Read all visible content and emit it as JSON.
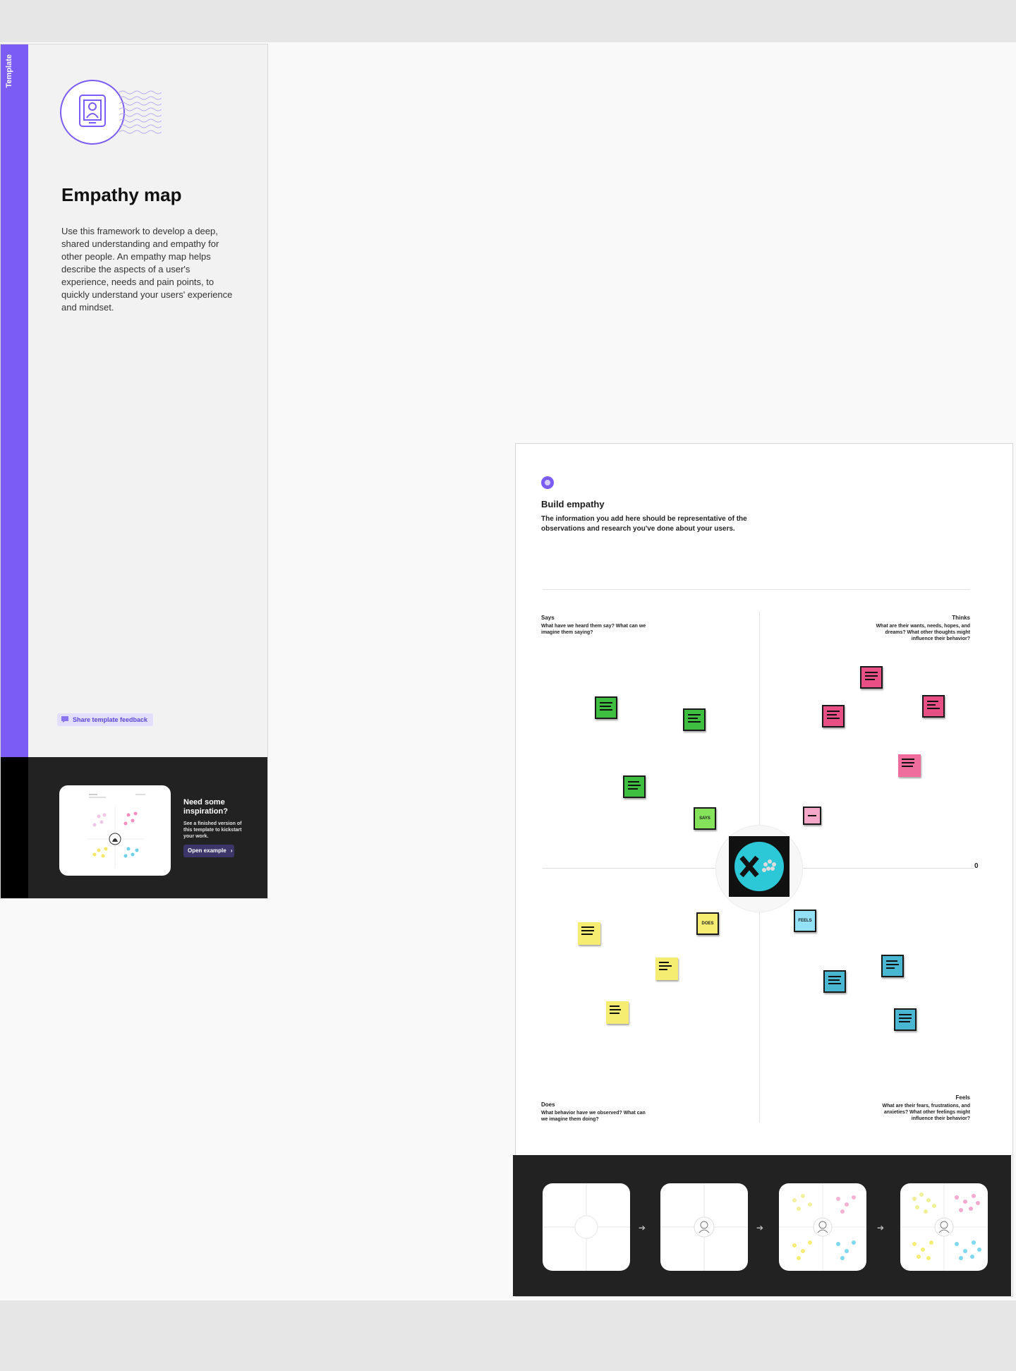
{
  "template_panel": {
    "strip_label": "Template",
    "title": "Empathy map",
    "description": "Use this framework to develop a deep, shared understanding and empathy for other people. An empathy map helps describe the aspects of a user's experience, needs and pain points, to quickly understand your users' experience and mindset.",
    "feedback_label": "Share template feedback",
    "inspiration": {
      "title": "Need some inspiration?",
      "subtitle": "See a finished version of this template to kickstart your work.",
      "button_label": "Open example"
    }
  },
  "board": {
    "title": "Build empathy",
    "subtitle": "The information you add here should be representative of the observations and research you've done about your users.",
    "axis_end_label": "0",
    "quadrants": [
      {
        "key": "says",
        "title": "Says",
        "prompt": "What have we heard them say? What can we imagine them saying?"
      },
      {
        "key": "thinks",
        "title": "Thinks",
        "prompt": "What are their wants, needs, hopes, and dreams? What other thoughts might influence their behavior?"
      },
      {
        "key": "does",
        "title": "Does",
        "prompt": "What behavior have we observed? What can we imagine them doing?"
      },
      {
        "key": "feels",
        "title": "Feels",
        "prompt": "What are their fears, frustrations, and anxieties? What other feelings might influence their behavior?"
      }
    ],
    "center_labels": {
      "says": "SAYS",
      "does": "DOES",
      "feels": "FEELS"
    }
  },
  "colors": {
    "accent": "#7b5cf5",
    "says": "#3fbf3f",
    "thinks": "#e84f84",
    "does": "#f4ed72",
    "feels": "#49b6d2"
  }
}
